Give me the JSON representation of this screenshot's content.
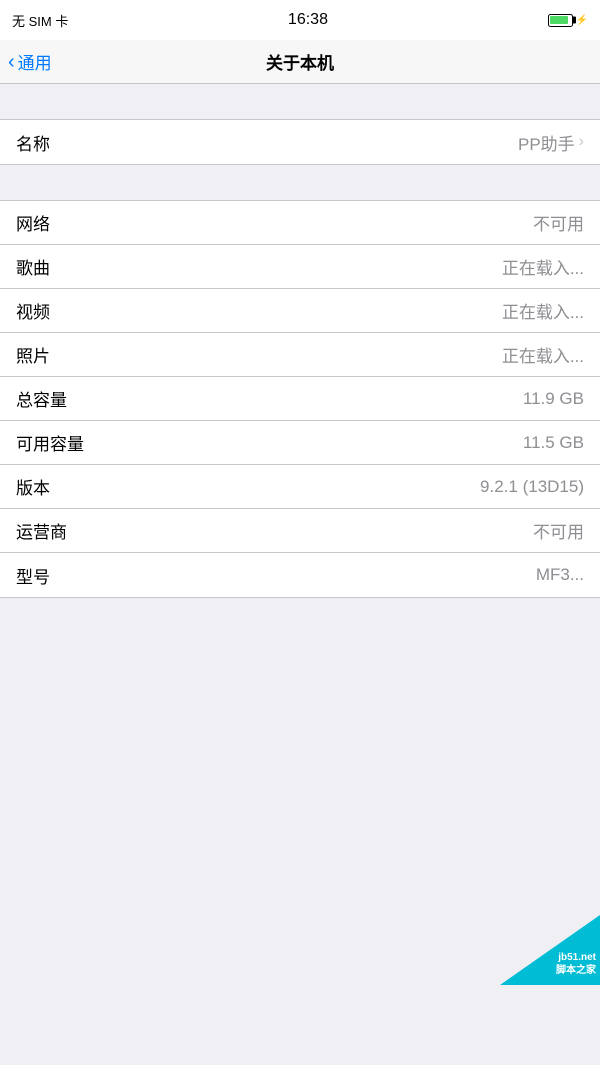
{
  "statusBar": {
    "left": "无 SIM 卡",
    "time": "16:38"
  },
  "navBar": {
    "backLabel": "通用",
    "title": "关于本机"
  },
  "rows": [
    {
      "id": "name",
      "label": "名称",
      "value": "PP助手",
      "hasChevron": true
    },
    {
      "id": "network",
      "label": "网络",
      "value": "不可用",
      "hasChevron": false
    },
    {
      "id": "songs",
      "label": "歌曲",
      "value": "正在载入...",
      "hasChevron": false
    },
    {
      "id": "videos",
      "label": "视频",
      "value": "正在载入...",
      "hasChevron": false
    },
    {
      "id": "photos",
      "label": "照片",
      "value": "正在载入...",
      "hasChevron": false
    },
    {
      "id": "total-capacity",
      "label": "总容量",
      "value": "11.9 GB",
      "hasChevron": false
    },
    {
      "id": "available-capacity",
      "label": "可用容量",
      "value": "11.5 GB",
      "hasChevron": false
    },
    {
      "id": "version",
      "label": "版本",
      "value": "9.2.1 (13D15)",
      "hasChevron": false
    },
    {
      "id": "carrier",
      "label": "运营商",
      "value": "不可用",
      "hasChevron": false
    },
    {
      "id": "model",
      "label": "型号",
      "value": "MF3...",
      "hasChevron": false
    }
  ],
  "watermark": {
    "line1": "jb51.net",
    "line2": "脚本之家"
  }
}
